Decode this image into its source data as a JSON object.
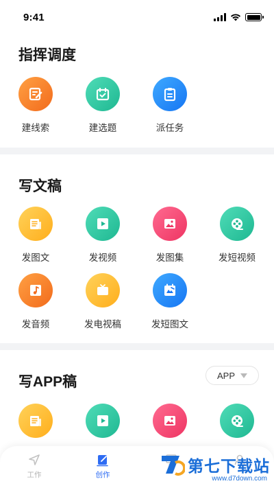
{
  "status_bar": {
    "time": "9:41"
  },
  "sections": {
    "command": {
      "title": "指挥调度",
      "items": [
        {
          "label": "建线索",
          "icon": "edit-note-icon",
          "color": "#f26b1c"
        },
        {
          "label": "建选题",
          "icon": "calendar-check-icon",
          "color": "#1fb892"
        },
        {
          "label": "派任务",
          "icon": "clipboard-icon",
          "color": "#1676f3"
        }
      ]
    },
    "write": {
      "title": "写文稿",
      "items": [
        {
          "label": "发图文",
          "icon": "newspaper-icon",
          "color": "#ffae1c"
        },
        {
          "label": "发视频",
          "icon": "play-icon",
          "color": "#1fb892"
        },
        {
          "label": "发图集",
          "icon": "image-icon",
          "color": "#ee3563"
        },
        {
          "label": "发短视频",
          "icon": "film-reel-icon",
          "color": "#1fb892"
        },
        {
          "label": "发音频",
          "icon": "music-note-icon",
          "color": "#f26b1c"
        },
        {
          "label": "发电视稿",
          "icon": "tv-icon",
          "color": "#ffae1c"
        },
        {
          "label": "发短图文",
          "icon": "short-article-icon",
          "color": "#1676f3"
        }
      ]
    },
    "app": {
      "title": "写APP稿",
      "selector": {
        "value": "APP"
      },
      "items": [
        {
          "icon": "newspaper-icon",
          "color": "#ffae1c"
        },
        {
          "icon": "play-icon",
          "color": "#1fb892"
        },
        {
          "icon": "image-icon",
          "color": "#ee3563"
        },
        {
          "icon": "film-reel-icon",
          "color": "#1fb892"
        }
      ]
    }
  },
  "tabbar": {
    "tabs": [
      {
        "label": "工作",
        "icon": "send-icon",
        "active": false
      },
      {
        "label": "创作",
        "icon": "compose-icon",
        "active": true
      },
      {
        "label": "",
        "icon": "screen-icon",
        "active": false
      },
      {
        "label": "",
        "icon": "user-icon",
        "active": false
      }
    ],
    "accent": "#2e6cf3"
  },
  "watermark": {
    "text": "第七下载站",
    "url": "www.d7down.com"
  }
}
